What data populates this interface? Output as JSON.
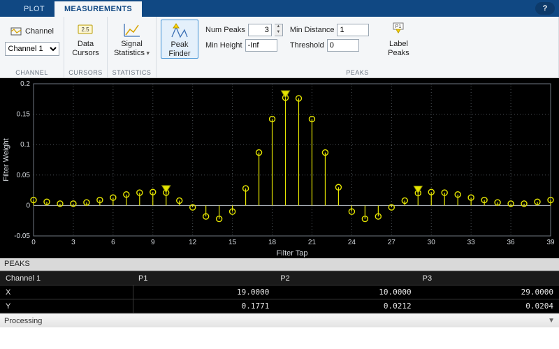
{
  "tabs": {
    "plot": "PLOT",
    "measurements": "MEASUREMENTS"
  },
  "help": "?",
  "ribbon": {
    "channel": {
      "label": "Channel",
      "selected": "Channel 1",
      "group": "CHANNEL"
    },
    "cursors": {
      "label1": "Data",
      "label2": "Cursors",
      "group": "CURSORS"
    },
    "statistics": {
      "label1": "Signal",
      "label2": "Statistics",
      "group": "STATISTICS"
    },
    "peaks": {
      "finder1": "Peak",
      "finder2": "Finder",
      "num_peaks_label": "Num Peaks",
      "num_peaks": "3",
      "min_dist_label": "Min Distance",
      "min_dist": "1",
      "min_height_label": "Min Height",
      "min_height": "-Inf",
      "threshold_label": "Threshold",
      "threshold": "0",
      "labelpeaks1": "Label",
      "labelpeaks2": "Peaks",
      "group": "PEAKS"
    }
  },
  "chart_data": {
    "type": "stem",
    "title": "",
    "xlabel": "Filter Tap",
    "ylabel": "Filter Weight",
    "xlim": [
      0,
      39
    ],
    "ylim": [
      -0.05,
      0.2
    ],
    "xticks": [
      0,
      3,
      6,
      9,
      12,
      15,
      18,
      21,
      24,
      27,
      30,
      33,
      36,
      39
    ],
    "yticks": [
      -0.05,
      0,
      0.05,
      0.1,
      0.15,
      0.2
    ],
    "x": [
      0,
      1,
      2,
      3,
      4,
      5,
      6,
      7,
      8,
      9,
      10,
      11,
      12,
      13,
      14,
      15,
      16,
      17,
      18,
      19,
      20,
      21,
      22,
      23,
      24,
      25,
      26,
      27,
      28,
      29,
      30,
      31,
      32,
      33,
      34,
      35,
      36,
      37,
      38,
      39
    ],
    "y": [
      0.009,
      0.006,
      0.003,
      0.003,
      0.005,
      0.009,
      0.013,
      0.018,
      0.021,
      0.022,
      0.0212,
      0.008,
      -0.003,
      -0.018,
      -0.022,
      -0.01,
      0.028,
      0.087,
      0.142,
      0.1771,
      0.176,
      0.142,
      0.087,
      0.03,
      -0.01,
      -0.022,
      -0.018,
      -0.003,
      0.008,
      0.0204,
      0.022,
      0.021,
      0.018,
      0.013,
      0.009,
      0.005,
      0.003,
      0.003,
      0.006,
      0.009
    ],
    "peaks": [
      {
        "name": "P1",
        "x": 19.0,
        "y": 0.1771
      },
      {
        "name": "P2",
        "x": 10.0,
        "y": 0.0212
      },
      {
        "name": "P3",
        "x": 29.0,
        "y": 0.0204
      }
    ]
  },
  "peaks_panel": {
    "title": "PEAKS",
    "channel_header": "Channel 1",
    "cols": [
      "P1",
      "P2",
      "P3"
    ],
    "rows": [
      {
        "label": "X",
        "vals": [
          "19.0000",
          "10.0000",
          "29.0000"
        ]
      },
      {
        "label": "Y",
        "vals": [
          "0.1771",
          "0.0212",
          "0.0204"
        ]
      }
    ]
  },
  "status": {
    "text": "Processing"
  }
}
